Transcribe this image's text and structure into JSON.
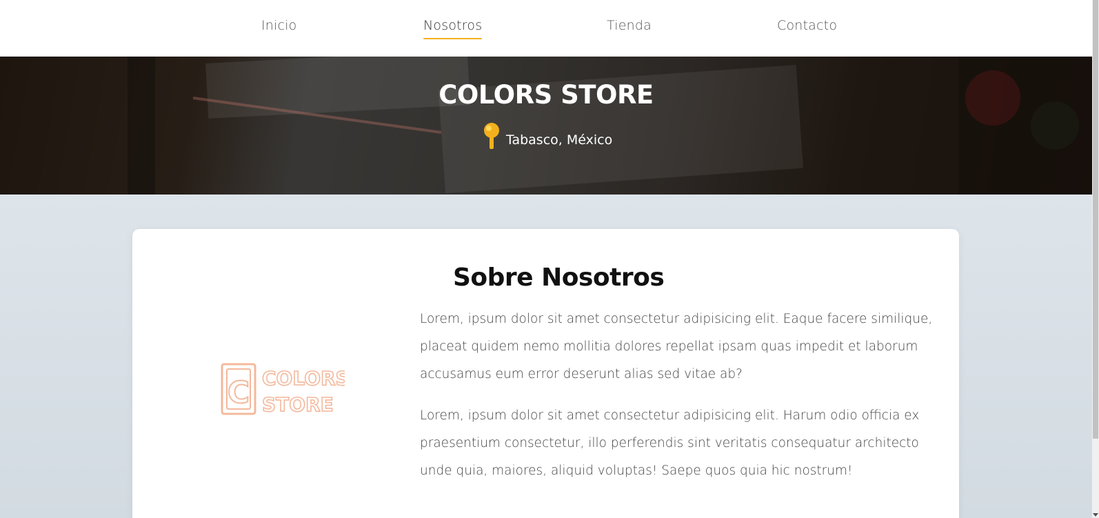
{
  "nav": {
    "items": [
      {
        "label": "Inicio",
        "active": false
      },
      {
        "label": "Nosotros",
        "active": true
      },
      {
        "label": "Tienda",
        "active": false
      },
      {
        "label": "Contacto",
        "active": false
      }
    ]
  },
  "hero": {
    "title": "COLORS STORE",
    "location": "Tabasco, México",
    "location_icon": "map-pin-icon"
  },
  "about": {
    "logo_text_line1": "COLORS",
    "logo_text_line2": "STORE",
    "logo_letter": "C",
    "title": "Sobre Nosotros",
    "paragraphs": [
      "Lorem, ipsum dolor sit amet consectetur adipisicing elit. Eaque facere similique, placeat quidem nemo mollitia dolores repellat ipsam quas impedit et laborum accusamus eum error deserunt alias sed vitae ab?",
      "Lorem, ipsum dolor sit amet consectetur adipisicing elit. Harum odio officia ex praesentium consectetur, illo perferendis sint veritatis consequatur architecto unde quia, maiores, aliquid voluptas! Saepe quos quia hic nostrum!"
    ]
  },
  "colors": {
    "accent": "#f2b11c",
    "logo": "#f4a582",
    "background": "#dde4ea"
  }
}
